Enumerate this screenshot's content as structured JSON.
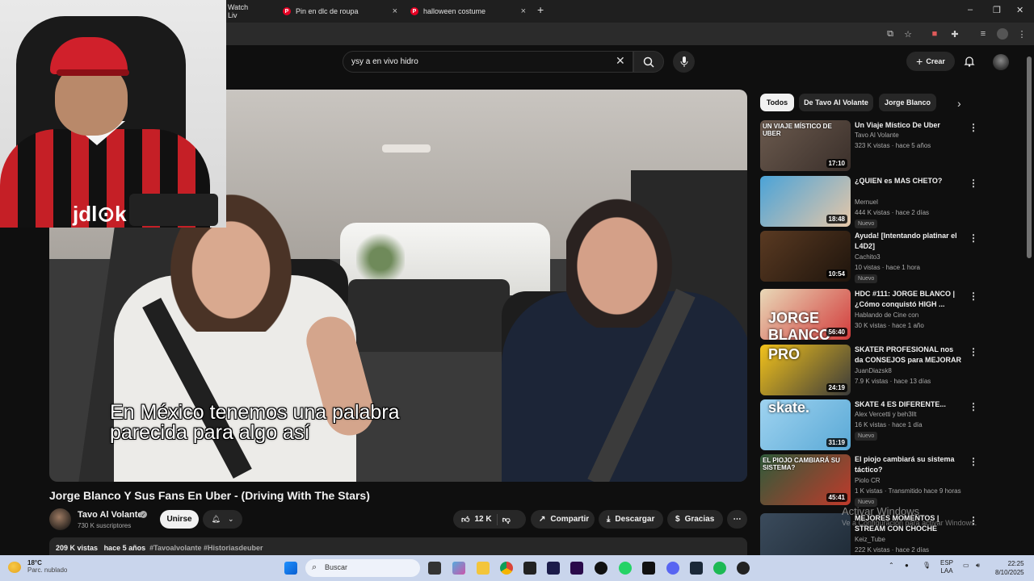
{
  "browser": {
    "tabs": [
      {
        "label": "Watch Liv"
      },
      {
        "label": "Pin en dlc de roupa"
      },
      {
        "label": "halloween costume"
      }
    ],
    "new_tab": "+",
    "win_min": "–",
    "win_max": "❐",
    "win_close": "✕"
  },
  "youtube": {
    "search_value": "ysy a en vivo hidro",
    "create_label": "Crear",
    "create_plus": "+"
  },
  "video": {
    "subtitle_line1": "En México tenemos una palabra",
    "subtitle_line2": "parecida para algo así",
    "title": "Jorge Blanco Y Sus Fans En Uber - (Driving With The Stars)",
    "channel": "Tavo Al Volante",
    "subscribers": "730 K suscriptores",
    "join_label": "Unirse",
    "likes": "12 K",
    "share_label": "Compartir",
    "download_label": "Descargar",
    "thanks_label": "Gracias",
    "views": "209 K vistas",
    "age": "hace 5 años",
    "tags": "#Tavoalvolante #Historiasdeuber"
  },
  "webcam": {
    "shirt_logo": "jdl⊙k"
  },
  "chips": [
    {
      "label": "Todos"
    },
    {
      "label": "De Tavo Al Volante"
    },
    {
      "label": "Jorge Blanco"
    }
  ],
  "recommendations": [
    {
      "title": "Un Viaje Místico De Uber",
      "channel": "Tavo Al Volante",
      "meta": "323 K vistas · hace 5 años",
      "duration": "17:10",
      "overlay": "UN VIAJE MÍSTICO DE UBER",
      "badge": "",
      "colors": [
        "#6b5a4e",
        "#3a2f2a"
      ]
    },
    {
      "title": "¿QUIEN es MAS CHETO?",
      "channel": "Mernuel",
      "meta": "444 K vistas · hace 2 días",
      "duration": "18:48",
      "overlay": "",
      "badge": "Nuevo",
      "colors": [
        "#4aa3d8",
        "#e6c7a8"
      ]
    },
    {
      "title": "Ayuda! [Intentando platinar el L4D2]",
      "channel": "Cachito3",
      "meta": "10 vistas · hace 1 hora",
      "duration": "10:54",
      "overlay": "",
      "badge": "Nuevo",
      "colors": [
        "#5a3a22",
        "#1e140c"
      ]
    },
    {
      "title": "HDC #111: JORGE BLANCO | ¿Cómo conquistó HIGH ...",
      "channel": "Hablando de Cine con",
      "meta": "30 K vistas · hace 1 año",
      "duration": "56:40",
      "overlay": "JORGE BLANCO",
      "badge": "",
      "colors": [
        "#e9d9b8",
        "#d23b3b"
      ]
    },
    {
      "title": "SKATER PROFESIONAL nos da CONSEJOS para MEJORAR | ...",
      "channel": "JuanDiazsk8",
      "meta": "7.9 K vistas · hace 13 días",
      "duration": "24:19",
      "overlay": "PRO",
      "badge": "",
      "colors": [
        "#f2c21b",
        "#3a3a3a"
      ]
    },
    {
      "title": "SKATE 4 ES DIFERENTE...",
      "channel": "Alex Vercetti y beh3llt",
      "meta": "16 K vistas · hace 1 día",
      "duration": "31:19",
      "overlay": "skate.",
      "badge": "Nuevo",
      "colors": [
        "#9fd3f0",
        "#5aa9d6"
      ]
    },
    {
      "title": "El piojo cambiará su sistema táctico?",
      "channel": "Piolo CR",
      "meta": "1 K vistas · Transmitido hace 9 horas",
      "duration": "45:41",
      "overlay": "EL PIOJO CAMBIARÁ SU SISTEMA?",
      "badge": "Nuevo",
      "colors": [
        "#2f5b3a",
        "#c03a2b"
      ]
    },
    {
      "title": "MEJORES MOMENTOS | STREAM CON CHOCHE",
      "channel": "Keiz_Tube",
      "meta": "222 K vistas · hace 2 días",
      "duration": "",
      "overlay": "",
      "badge": "",
      "colors": [
        "#3b4b5c",
        "#1e2a36"
      ]
    }
  ],
  "watermark": {
    "line1": "Activar Windows",
    "line2": "Ve a Configuración para activar Windows."
  },
  "taskbar": {
    "temp": "18°C",
    "weather": "Parc. nublado",
    "search": "Buscar",
    "lang1": "ESP",
    "lang2": "LAA",
    "time": "22:25",
    "date": "8/10/2025"
  }
}
